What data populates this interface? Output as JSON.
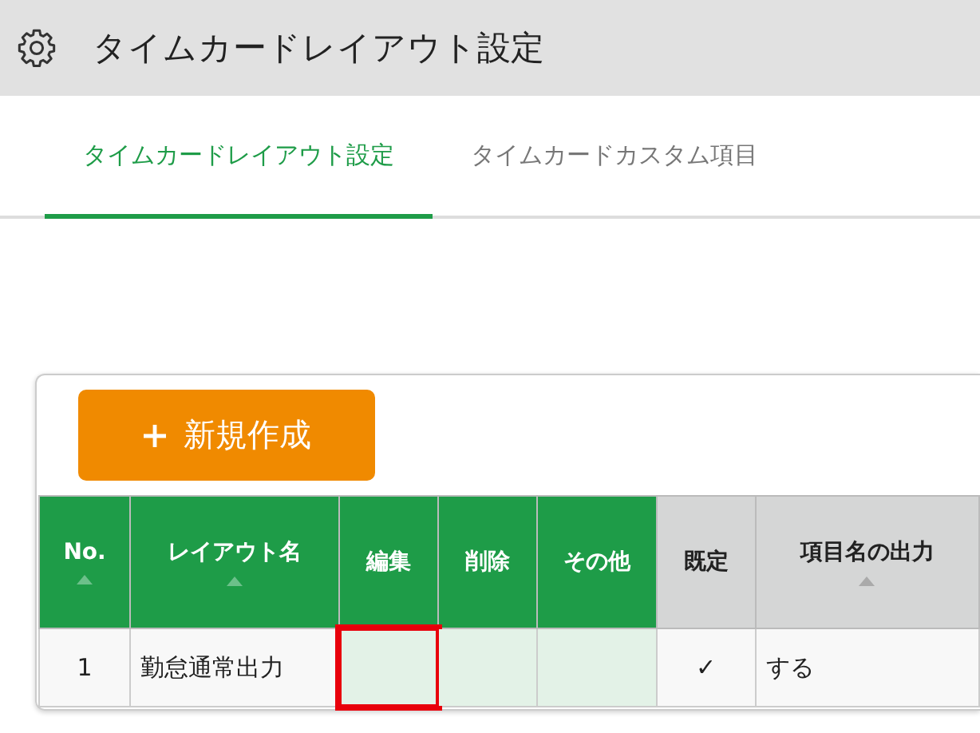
{
  "header": {
    "title": "タイムカードレイアウト設定"
  },
  "tabs": [
    {
      "label": "タイムカードレイアウト設定",
      "selected": true
    },
    {
      "label": "タイムカードカスタム項目",
      "selected": false
    }
  ],
  "new_button": {
    "label": "新規作成"
  },
  "table": {
    "columns": [
      {
        "label": "No.",
        "kind": "data",
        "sortable": true,
        "color": "#1e9c48"
      },
      {
        "label": "レイアウト名",
        "kind": "data",
        "sortable": true,
        "color": "#1e9c48"
      },
      {
        "label": "編集",
        "kind": "action",
        "sortable": false,
        "color": "#1e9c48"
      },
      {
        "label": "削除",
        "kind": "action",
        "sortable": false,
        "color": "#1e9c48"
      },
      {
        "label": "その他",
        "kind": "action",
        "sortable": false,
        "color": "#1e9c48"
      },
      {
        "label": "既定",
        "kind": "data",
        "sortable": false,
        "color": "#d5d6d6"
      },
      {
        "label": "項目名の出力",
        "kind": "data",
        "sortable": true,
        "color": "#d5d6d6"
      }
    ],
    "rows": [
      {
        "cells": [
          {
            "text": "1",
            "highlighted": false
          },
          {
            "text": "勤怠通常出力",
            "highlighted": false
          },
          {
            "highlighted": true
          },
          {
            "highlighted": false
          },
          {
            "highlighted": false
          },
          {
            "text": "✓",
            "highlighted": false
          },
          {
            "text": "する",
            "highlighted": false
          }
        ]
      }
    ]
  }
}
